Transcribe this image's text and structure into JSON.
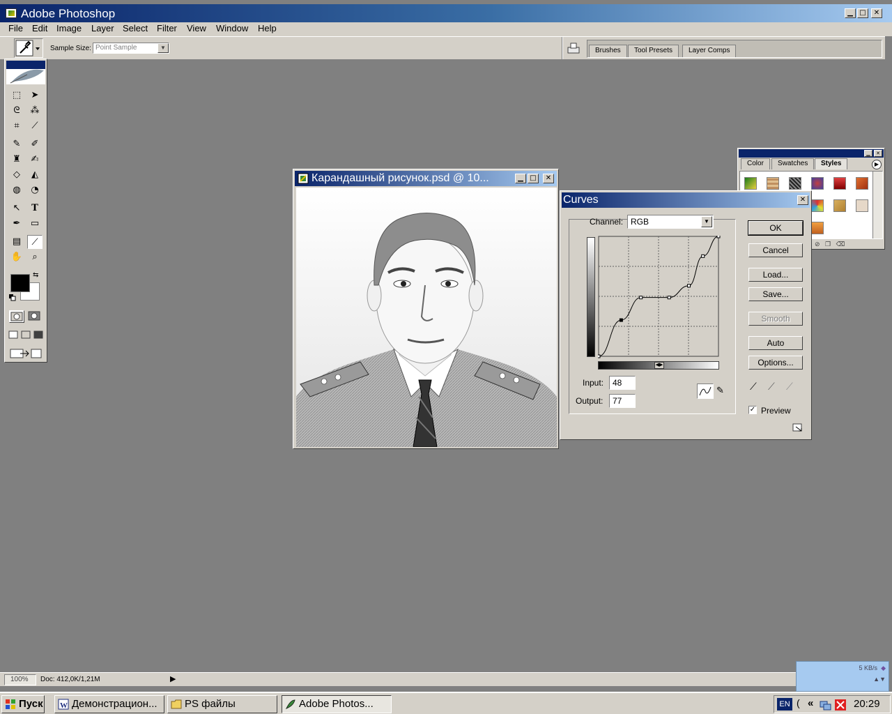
{
  "app": {
    "title": "Adobe Photoshop"
  },
  "menu": [
    "File",
    "Edit",
    "Image",
    "Layer",
    "Select",
    "Filter",
    "View",
    "Window",
    "Help"
  ],
  "options": {
    "sample_size_label": "Sample Size:",
    "sample_size_value": "Point Sample",
    "well_tabs": [
      "Brushes",
      "Tool Presets",
      "Layer Comps"
    ]
  },
  "document": {
    "title": "Карандашный рисунок.psd @ 10..."
  },
  "curves": {
    "title": "Curves",
    "channel_label": "Channel:",
    "channel_value": "RGB",
    "input_label": "Input:",
    "input_value": "48",
    "output_label": "Output:",
    "output_value": "77",
    "buttons": {
      "ok": "OK",
      "cancel": "Cancel",
      "load": "Load...",
      "save": "Save...",
      "smooth": "Smooth",
      "auto": "Auto",
      "options": "Options..."
    },
    "preview_label": "Preview",
    "preview_checked": true,
    "points": [
      [
        0,
        0
      ],
      [
        48,
        77
      ],
      [
        90,
        125
      ],
      [
        150,
        125
      ],
      [
        192,
        150
      ],
      [
        222,
        213
      ],
      [
        255,
        255
      ]
    ]
  },
  "styles_palette": {
    "tabs": [
      "Color",
      "Swatches",
      "Styles"
    ],
    "active_tab": "Styles"
  },
  "status": {
    "zoom": "100%",
    "doc": "Doc: 412,0K/1,21M"
  },
  "network": {
    "speed": "5 KB/s"
  },
  "taskbar": {
    "start": "Пуск",
    "items": [
      "Демонстрацион...",
      "PS файлы",
      "Adobe Photos..."
    ],
    "lang": "EN",
    "time": "20:29"
  }
}
